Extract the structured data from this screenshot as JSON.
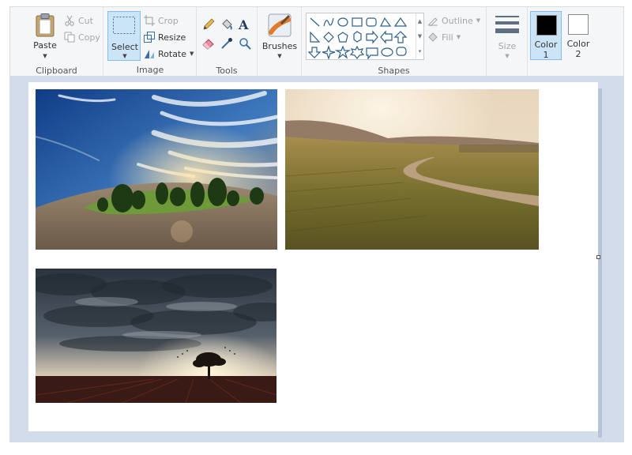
{
  "ribbon": {
    "clipboard": {
      "group_label": "Clipboard",
      "paste_label": "Paste",
      "cut_label": "Cut",
      "copy_label": "Copy"
    },
    "image": {
      "group_label": "Image",
      "select_label": "Select",
      "crop_label": "Crop",
      "resize_label": "Resize",
      "rotate_label": "Rotate"
    },
    "tools": {
      "group_label": "Tools",
      "items": [
        "pencil-icon",
        "fill-bucket-icon",
        "text-icon",
        "eraser-icon",
        "color-picker-icon",
        "magnifier-icon"
      ]
    },
    "brushes": {
      "label": "Brushes"
    },
    "shapes": {
      "group_label": "Shapes",
      "outline_label": "Outline",
      "fill_label": "Fill"
    },
    "size": {
      "label": "Size"
    },
    "colors": {
      "color1_line1": "Color",
      "color1_line2": "1",
      "color2_line1": "Color",
      "color2_line2": "2",
      "color1_value": "#000000",
      "color2_value": "#ffffff"
    }
  },
  "canvas": {
    "photos": [
      {
        "name": "photo-cloud-sky-trees",
        "subject": "streaking clouds over a green island of trees"
      },
      {
        "name": "photo-sunrise-field",
        "subject": "sunlit farm field with a dirt road"
      },
      {
        "name": "photo-stormy-sunset",
        "subject": "dark clouds over a lone tree at sunset"
      }
    ]
  },
  "colors": {
    "accent_select_bg": "#cce4f7",
    "accent_select_border": "#88bde6",
    "workspace_bg": "#d3dcea",
    "ribbon_bg": "#f5f6f7"
  }
}
